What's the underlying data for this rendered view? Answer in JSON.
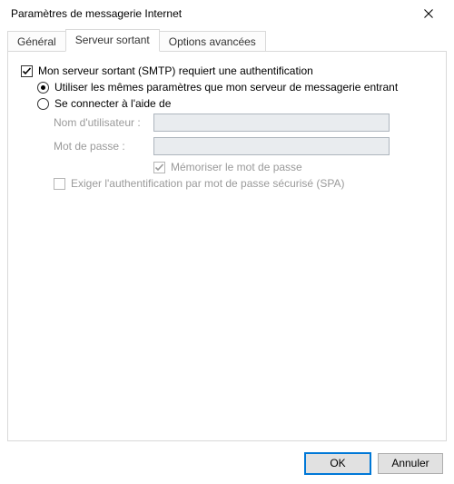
{
  "title": "Paramètres de messagerie Internet",
  "tabs": {
    "general": "Général",
    "outgoing": "Serveur sortant",
    "advanced": "Options avancées"
  },
  "content": {
    "smtp_auth": "Mon serveur sortant (SMTP) requiert une authentification",
    "use_same": "Utiliser les mêmes paramètres que mon serveur de messagerie entrant",
    "connect_using": "Se connecter à l'aide de",
    "username_label": "Nom d'utilisateur :",
    "password_label": "Mot de passe :",
    "remember_pw": "Mémoriser le mot de passe",
    "spa": "Exiger l'authentification par mot de passe sécurisé (SPA)"
  },
  "buttons": {
    "ok": "OK",
    "cancel": "Annuler"
  }
}
